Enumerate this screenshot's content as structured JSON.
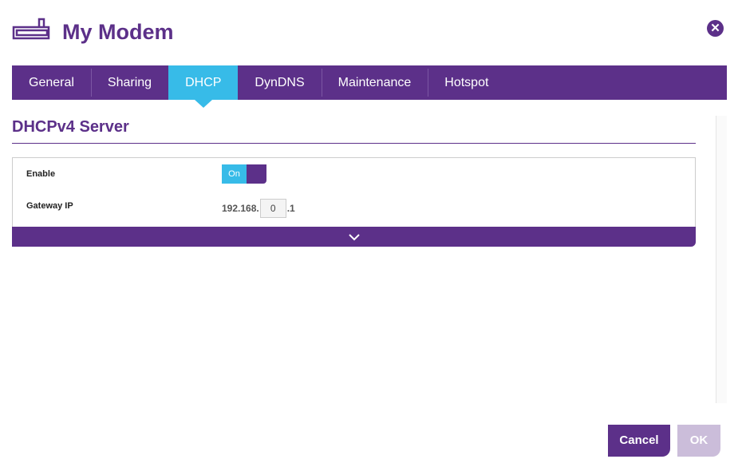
{
  "header": {
    "title": "My Modem"
  },
  "tabs": [
    {
      "label": "General"
    },
    {
      "label": "Sharing"
    },
    {
      "label": "DHCP"
    },
    {
      "label": "DynDNS"
    },
    {
      "label": "Maintenance"
    },
    {
      "label": "Hotspot"
    }
  ],
  "section": {
    "title": "DHCPv4 Server"
  },
  "form": {
    "enable_label": "Enable",
    "enable_value": "On",
    "gateway_label": "Gateway IP",
    "gateway_prefix": "192.168.",
    "gateway_octet": "0",
    "gateway_suffix": ".1"
  },
  "footer": {
    "cancel": "Cancel",
    "ok": "OK"
  }
}
